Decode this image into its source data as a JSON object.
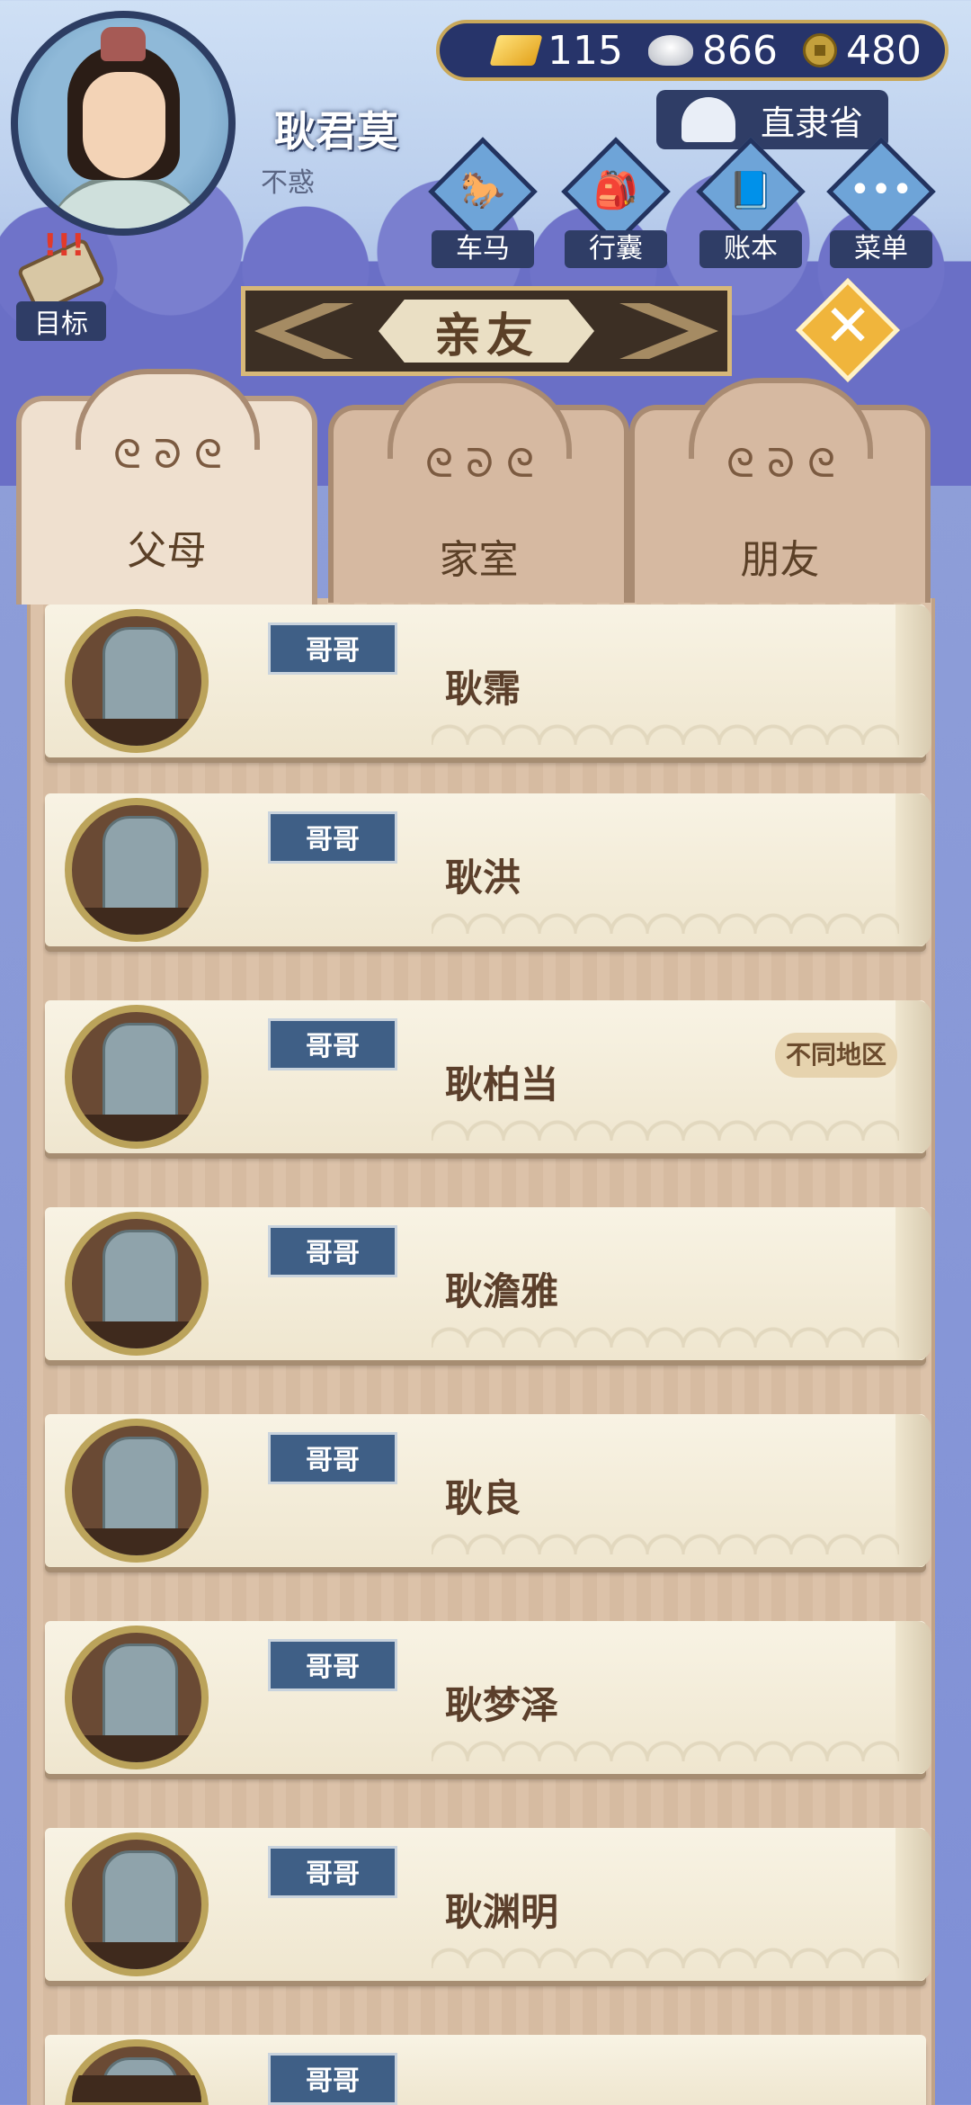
{
  "player": {
    "name": "耿君莫",
    "age_label": "不惑"
  },
  "currency": {
    "gold": "115",
    "silver": "866",
    "coins": "480"
  },
  "location": "直隶省",
  "menu": [
    {
      "label": "车马",
      "icon": "carriage-icon",
      "glyph": "🐎"
    },
    {
      "label": "行囊",
      "icon": "bag-icon",
      "glyph": "🎒"
    },
    {
      "label": "账本",
      "icon": "ledger-icon",
      "glyph": "📘"
    },
    {
      "label": "菜单",
      "icon": "menu-dots-icon",
      "glyph": "•••"
    }
  ],
  "goal": {
    "label": "目标",
    "alert": "!!!"
  },
  "title": "亲友",
  "tabs": [
    {
      "label": "父母",
      "active": true
    },
    {
      "label": "家室",
      "active": false
    },
    {
      "label": "朋友",
      "active": false
    }
  ],
  "relatives": [
    {
      "relation": "哥哥",
      "name": "耿霈",
      "badge": ""
    },
    {
      "relation": "哥哥",
      "name": "耿洪",
      "badge": ""
    },
    {
      "relation": "哥哥",
      "name": "耿柏当",
      "badge": "不同地区"
    },
    {
      "relation": "哥哥",
      "name": "耿澹雅",
      "badge": ""
    },
    {
      "relation": "哥哥",
      "name": "耿良",
      "badge": ""
    },
    {
      "relation": "哥哥",
      "name": "耿梦泽",
      "badge": ""
    },
    {
      "relation": "哥哥",
      "name": "耿渊明",
      "badge": ""
    },
    {
      "relation": "哥哥",
      "name": "",
      "badge": ""
    }
  ],
  "colors": {
    "accent_gold": "#d7b879",
    "panel_navy": "#2f3d66",
    "relation_tag": "#3f5f86"
  }
}
